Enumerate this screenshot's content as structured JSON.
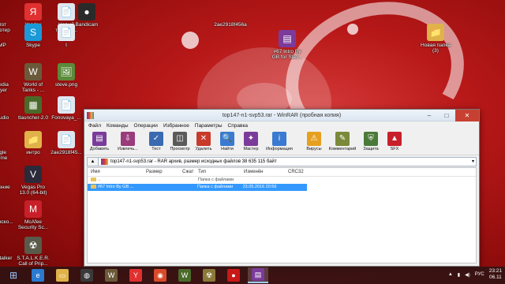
{
  "desktop": {
    "icons": [
      {
        "id": "ethot",
        "label": "этот\nпьютер",
        "glyph": "💻",
        "color": "#4a7fb5",
        "partial": true
      },
      {
        "id": "yandex",
        "label": "Yandex",
        "glyph": "Я",
        "color": "#e03030"
      },
      {
        "id": "noviy",
        "label": "Новый\nтекстов...",
        "glyph": "📄",
        "color": "#dfe6ee"
      },
      {
        "id": "bandicam",
        "label": "Bandicam",
        "glyph": "●",
        "color": "#2a2a2a"
      },
      {
        "id": "hash1",
        "label": "2ae2918f456a",
        "glyph": "",
        "color": "transparent"
      },
      {
        "id": "dmp",
        "label": "IMP",
        "glyph": "▶",
        "color": "#e8a020",
        "partial": true
      },
      {
        "id": "skype",
        "label": "Skype",
        "glyph": "S",
        "color": "#1a9ad8"
      },
      {
        "id": "t",
        "label": "t",
        "glyph": "📄",
        "color": "#e4e8ee"
      },
      {
        "id": "media",
        "label": "media\nlayer",
        "glyph": "▶",
        "color": "#3050a0",
        "partial": true
      },
      {
        "id": "wot",
        "label": "World of\nTanks - ...",
        "glyph": "W",
        "color": "#6b5a3a"
      },
      {
        "id": "steve",
        "label": "steve.png",
        "glyph": "🖼",
        "color": "#5b8a3a"
      },
      {
        "id": "studio",
        "label": "Studio",
        "glyph": "◎",
        "color": "#2a2a2a",
        "partial": true
      },
      {
        "id": "tlauncher",
        "label": "tlauncher-2.0",
        "glyph": "▦",
        "color": "#4a6a2a"
      },
      {
        "id": "fonovaya",
        "label": "Fonovaya_...",
        "glyph": "📄",
        "color": "#dfe6ee"
      },
      {
        "id": "chrome",
        "label": "ogle\nrome",
        "glyph": "◉",
        "color": "#d84a2a",
        "partial": true
      },
      {
        "id": "intro",
        "label": "интро",
        "glyph": "📁",
        "color": "#e0b24a"
      },
      {
        "id": "hash2",
        "label": "2ae2918f45...",
        "glyph": "📄",
        "color": "#dfe6ee"
      },
      {
        "id": "zhenie",
        "label": "вление",
        "glyph": "⚙",
        "color": "#888",
        "partial": true
      },
      {
        "id": "vegas",
        "label": "Vegas Pro\n13.0 (64-bit)",
        "glyph": "V",
        "color": "#2a2a3a"
      },
      {
        "id": "obj1",
        "label": "ановско...",
        "glyph": "G",
        "color": "#3aa84a",
        "partial": true
      },
      {
        "id": "mcafee",
        "label": "McAfee\nSecurity Sc...",
        "glyph": "M",
        "color": "#c8202a"
      },
      {
        "id": "obj2",
        "label": "S-Stalker",
        "glyph": "☣",
        "color": "#8a7a3a",
        "partial": true
      },
      {
        "id": "stalker",
        "label": "S.T.A.L.K.E.R.\nCall of Prip...",
        "glyph": "☢",
        "color": "#5a5a4a"
      },
      {
        "id": "rar_on_desktop",
        "label": "#67 Intro By\nGB for Stev...",
        "glyph": "▤",
        "color": "#7b3b9a"
      },
      {
        "id": "newfolder",
        "label": "Новая папка\n(3)",
        "glyph": "📁",
        "color": "#e0b24a"
      }
    ]
  },
  "window": {
    "title": "top147-n1-svp53.rar - RAR архив, размер исходных файлов 38 635 115 байт",
    "titlebar": "top147-n1-svp53.rar - WinRAR (пробная копия)",
    "menu": [
      "Файл",
      "Команды",
      "Операции",
      "Избранное",
      "Параметры",
      "Справка"
    ],
    "toolbar": [
      {
        "label": "Добавить",
        "glyph": "▤",
        "color": "#7b3b9a"
      },
      {
        "label": "Извлечь...",
        "glyph": "⇩",
        "color": "#9a3b7b"
      },
      {
        "label": "Тест",
        "glyph": "✓",
        "color": "#3a6ab0"
      },
      {
        "label": "Просмотр",
        "glyph": "◫",
        "color": "#5a5a5a"
      },
      {
        "label": "Удалить",
        "glyph": "✕",
        "color": "#c83a2a"
      },
      {
        "label": "Найти",
        "glyph": "🔍",
        "color": "#3a7ad1"
      },
      {
        "label": "Мастер",
        "glyph": "✦",
        "color": "#7b3b9a"
      },
      {
        "label": "Информация",
        "glyph": "i",
        "color": "#3a7ad1"
      },
      {
        "label": "Вирусы",
        "glyph": "⚠",
        "color": "#e6a020"
      },
      {
        "label": "Комментарий",
        "glyph": "✎",
        "color": "#7a8a3a"
      },
      {
        "label": "Защита",
        "glyph": "⛨",
        "color": "#4a7a3a"
      },
      {
        "label": "SFX",
        "glyph": "▲",
        "color": "#c8202a"
      }
    ],
    "path": "top147-n1-svp53.rar - RAR архив, размер исходных файлов 38 635 115 байт",
    "columns": [
      "Имя",
      "Размер",
      "Сжат",
      "Тип",
      "Изменён",
      "CRC32"
    ],
    "rows": [
      {
        "name": "..",
        "size": "",
        "packed": "",
        "type": "Папка с файлами",
        "modified": "",
        "crc": "",
        "selected": false
      },
      {
        "name": "#67 Intro By GB ...",
        "size": "",
        "packed": "",
        "type": "Папка с файлами",
        "modified": "23.05.2016 20:56",
        "crc": "",
        "selected": true
      }
    ]
  },
  "taskbar": {
    "items": [
      {
        "name": "ie-icon",
        "glyph": "e",
        "color": "#2a7ad1"
      },
      {
        "name": "explorer-icon",
        "glyph": "▭",
        "color": "#e0b24a"
      },
      {
        "name": "obs-icon",
        "glyph": "◍",
        "color": "#3a3a3a"
      },
      {
        "name": "wot-taskbar-icon",
        "glyph": "W",
        "color": "#6b5a3a"
      },
      {
        "name": "yandex-taskbar-icon",
        "glyph": "Y",
        "color": "#e03030"
      },
      {
        "name": "chrome-taskbar-icon",
        "glyph": "◉",
        "color": "#d84a2a"
      },
      {
        "name": "wot-taskbar-icon-2",
        "glyph": "W",
        "color": "#4a6a2a"
      },
      {
        "name": "stalker-taskbar-icon",
        "glyph": "☢",
        "color": "#8a7a3a"
      },
      {
        "name": "bandicam-taskbar-icon",
        "glyph": "●",
        "color": "#c81818"
      },
      {
        "name": "winrar-taskbar-icon",
        "glyph": "▤",
        "color": "#7b3b9a",
        "active": true
      }
    ],
    "lang": "РУС",
    "time": "23:21",
    "date": "06.11"
  }
}
